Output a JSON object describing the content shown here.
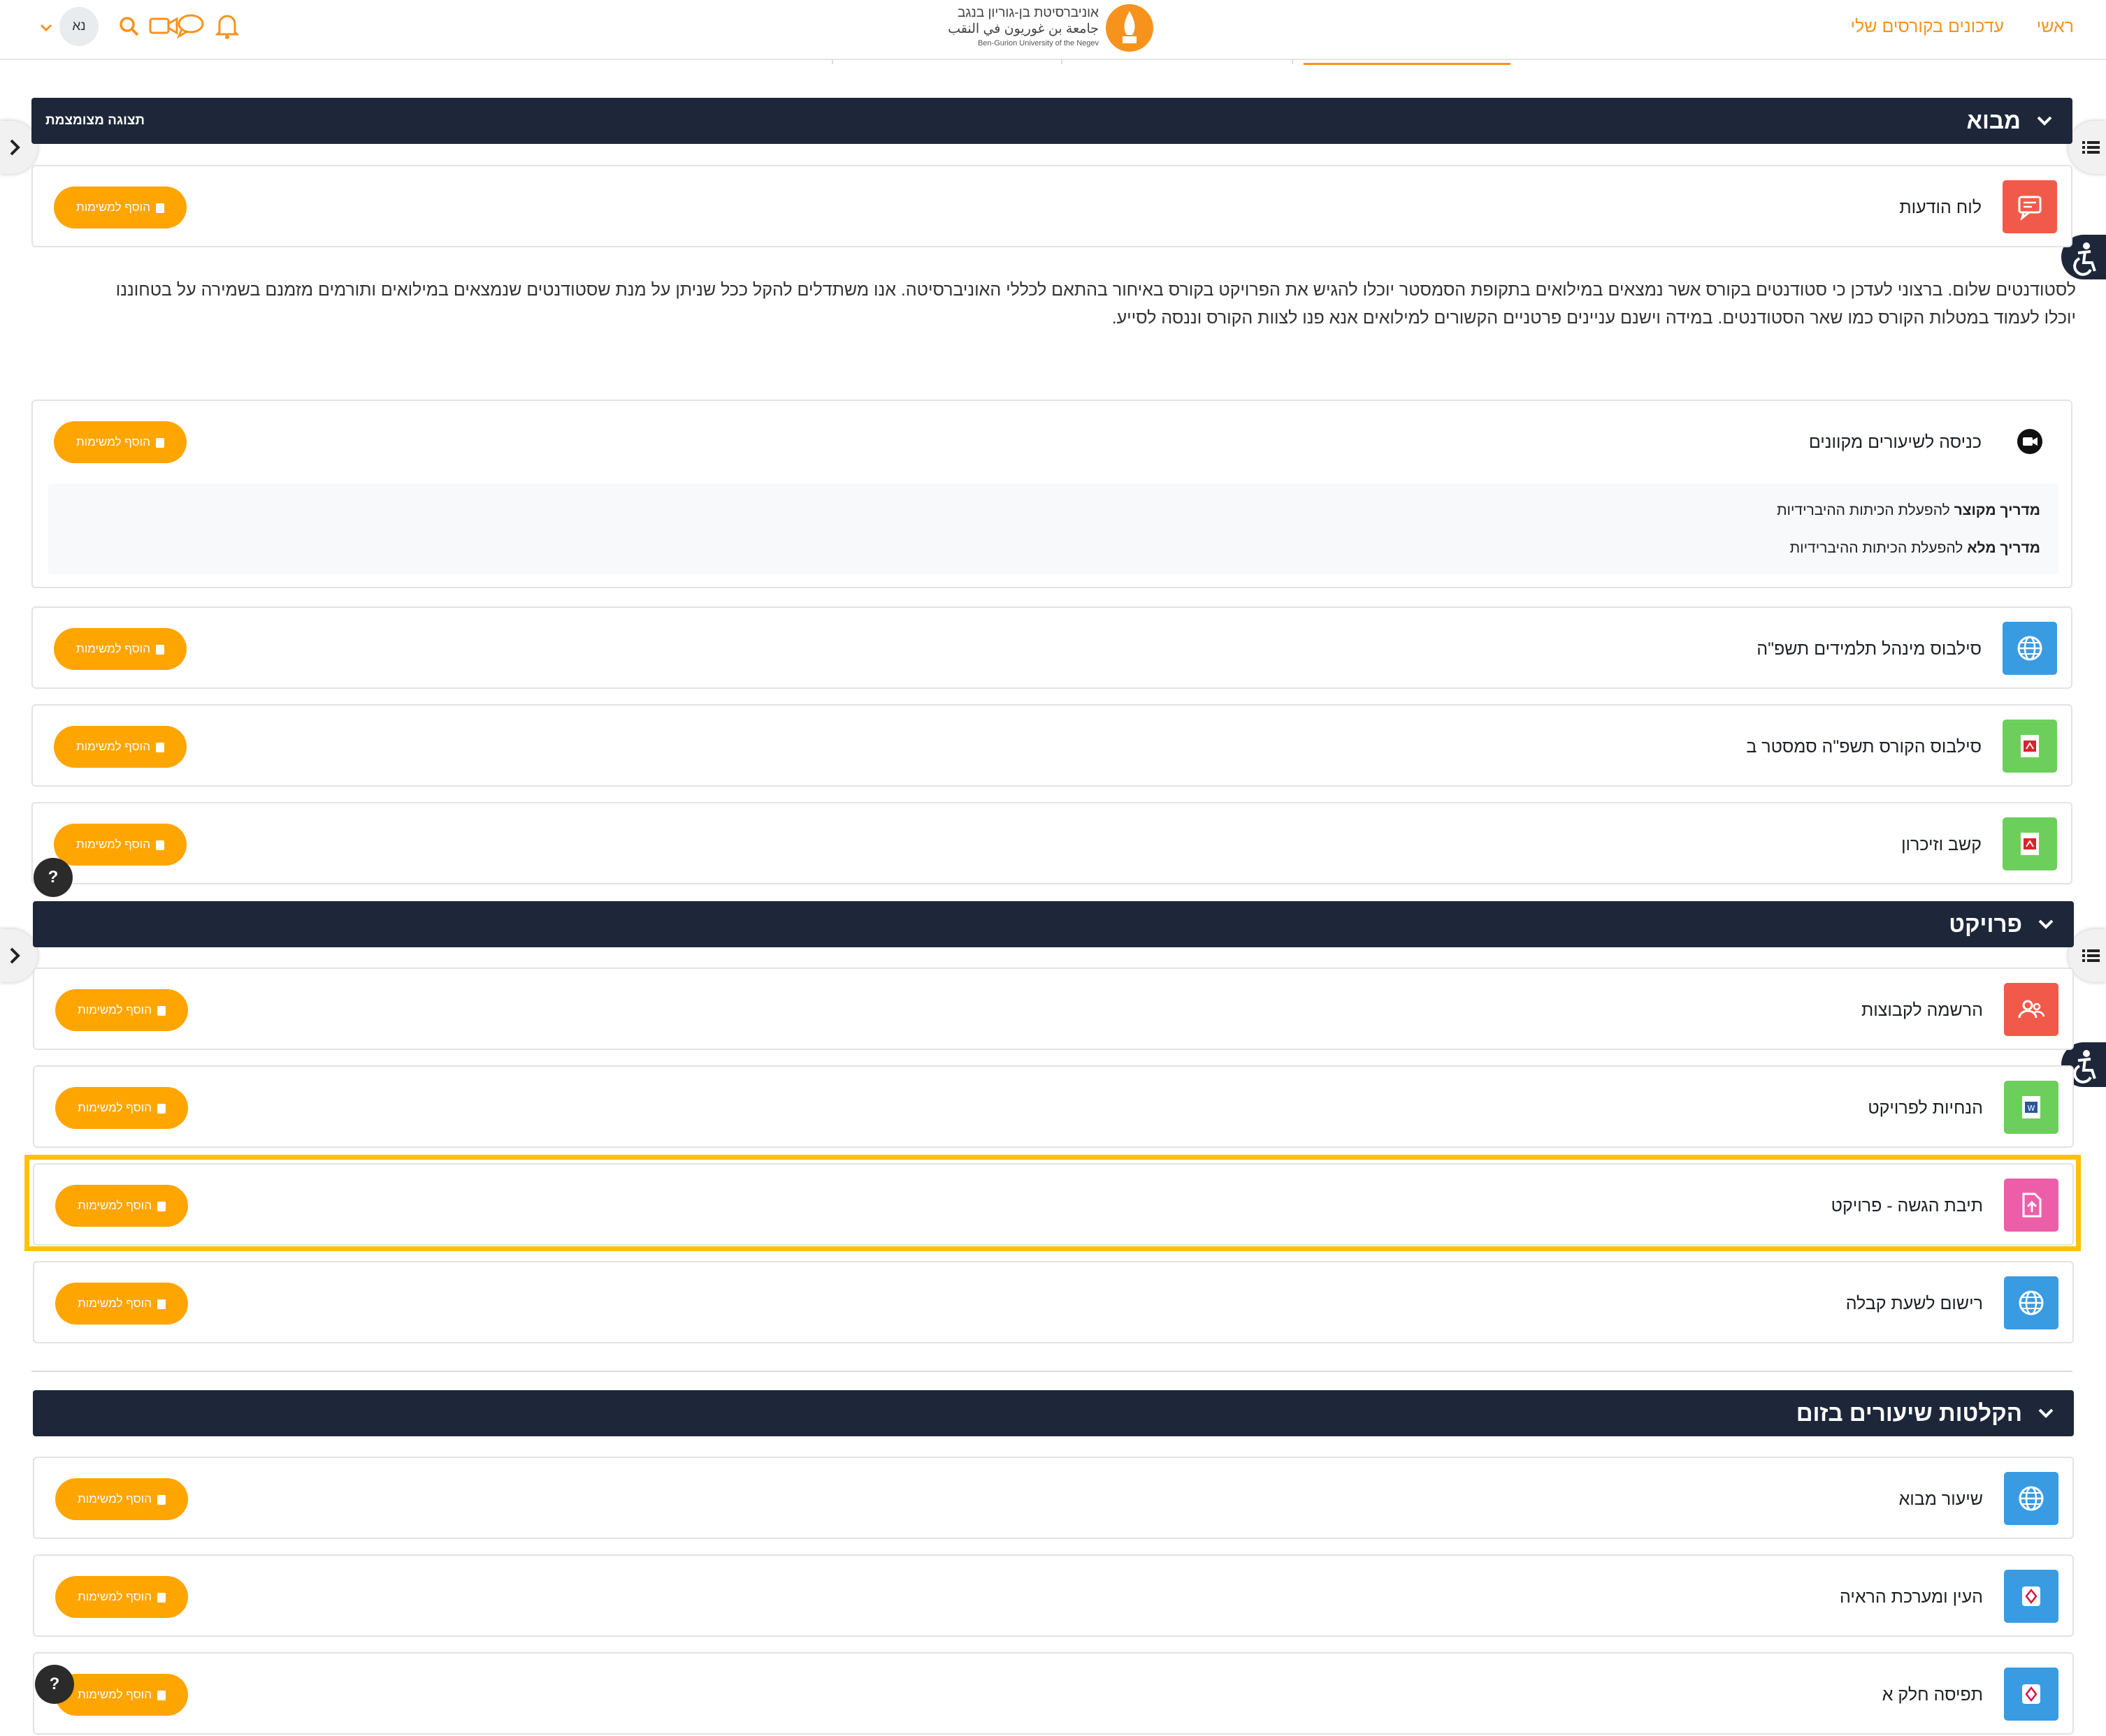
{
  "header": {
    "nav": [
      "ראשי",
      "עדכונים בקורסים שלי"
    ],
    "logo_he": "אוניברסיטת בן-גוריון בנגב",
    "logo_ar": "جامعة بن غوريون في النقب",
    "logo_en": "Ben-Gurion University of the Negev",
    "avatar_initials": "נא",
    "icons": [
      "bell-icon",
      "chat-icon",
      "video-icon",
      "search-icon",
      "chevron-down-icon"
    ]
  },
  "add_button_label": "הוסף למשימות",
  "sections": [
    {
      "title": "מבוא",
      "toggle_label": "תצוגה מצומצמת",
      "description": "לסטודנטים שלום. ברצוני לעדכן כי סטודנטים בקורס אשר נמצאים במילואים בתקופת הסמסטר יוכלו להגיש את הפרויקט בקורס באיחור בהתאם לכללי האוניברסיטה. אנו משתדלים להקל ככל שניתן על מנת שסטודנטים שנמצאים במילואים ותורמים מזמנם בשמירה על בטחוננו יוכלו לעמוד במטלות הקורס כמו שאר הסטודנטים. במידה וישנם עניינים פרטניים הקשורים למילואים אנא פנו לצוות הקורס וננסה לסייע.",
      "activities": [
        {
          "name": "לוח הודעות",
          "icon": "forum-icon",
          "color": "#f15a4a"
        },
        {
          "name": "כניסה לשיעורים מקוונים",
          "icon": "video-camera-icon",
          "color": "#ffffff",
          "guides": [
            {
              "bold": "מדריך מקוצר",
              "text": " להפעלת הכיתות ההיברידיות"
            },
            {
              "bold": "מדריך מלא",
              "text": " להפעלת הכיתות ההיברידיות"
            }
          ]
        },
        {
          "name": "סילבוס מינהל תלמידים תשפ\"ה",
          "icon": "globe-icon",
          "color": "#399be2"
        },
        {
          "name": "סילבוס הקורס תשפ\"ה סמסטר ב",
          "icon": "pdf-icon",
          "color": "#6ccf5c"
        },
        {
          "name": "קשב וזיכרון",
          "icon": "pdf-icon",
          "color": "#6ccf5c"
        }
      ]
    },
    {
      "title": "פרויקט",
      "activities": [
        {
          "name": "הרשמה לקבוצות",
          "icon": "group-icon",
          "color": "#f15a4a"
        },
        {
          "name": "הנחיות לפרויקט",
          "icon": "word-doc-icon",
          "color": "#6ccf5c"
        },
        {
          "name": "תיבת הגשה - פרויקט",
          "icon": "upload-file-icon",
          "color": "#ec5fa8"
        },
        {
          "name": "רישום לשעת קבלה",
          "icon": "globe-icon",
          "color": "#399be2"
        }
      ]
    },
    {
      "title": "הקלטות שיעורים בזום",
      "activities": [
        {
          "name": "שיעור מבוא",
          "icon": "globe-icon",
          "color": "#399be2"
        },
        {
          "name": "העין ומערכת הראיה",
          "icon": "h5p-icon",
          "color": "#399be2"
        },
        {
          "name": "תפיסה חלק א",
          "icon": "h5p-icon",
          "color": "#399be2"
        }
      ]
    }
  ],
  "help_label": "?",
  "colors": {
    "accent": "#f7931d",
    "button": "#ffa500",
    "section_bg": "#1d2739",
    "highlight": "#ffc107"
  }
}
